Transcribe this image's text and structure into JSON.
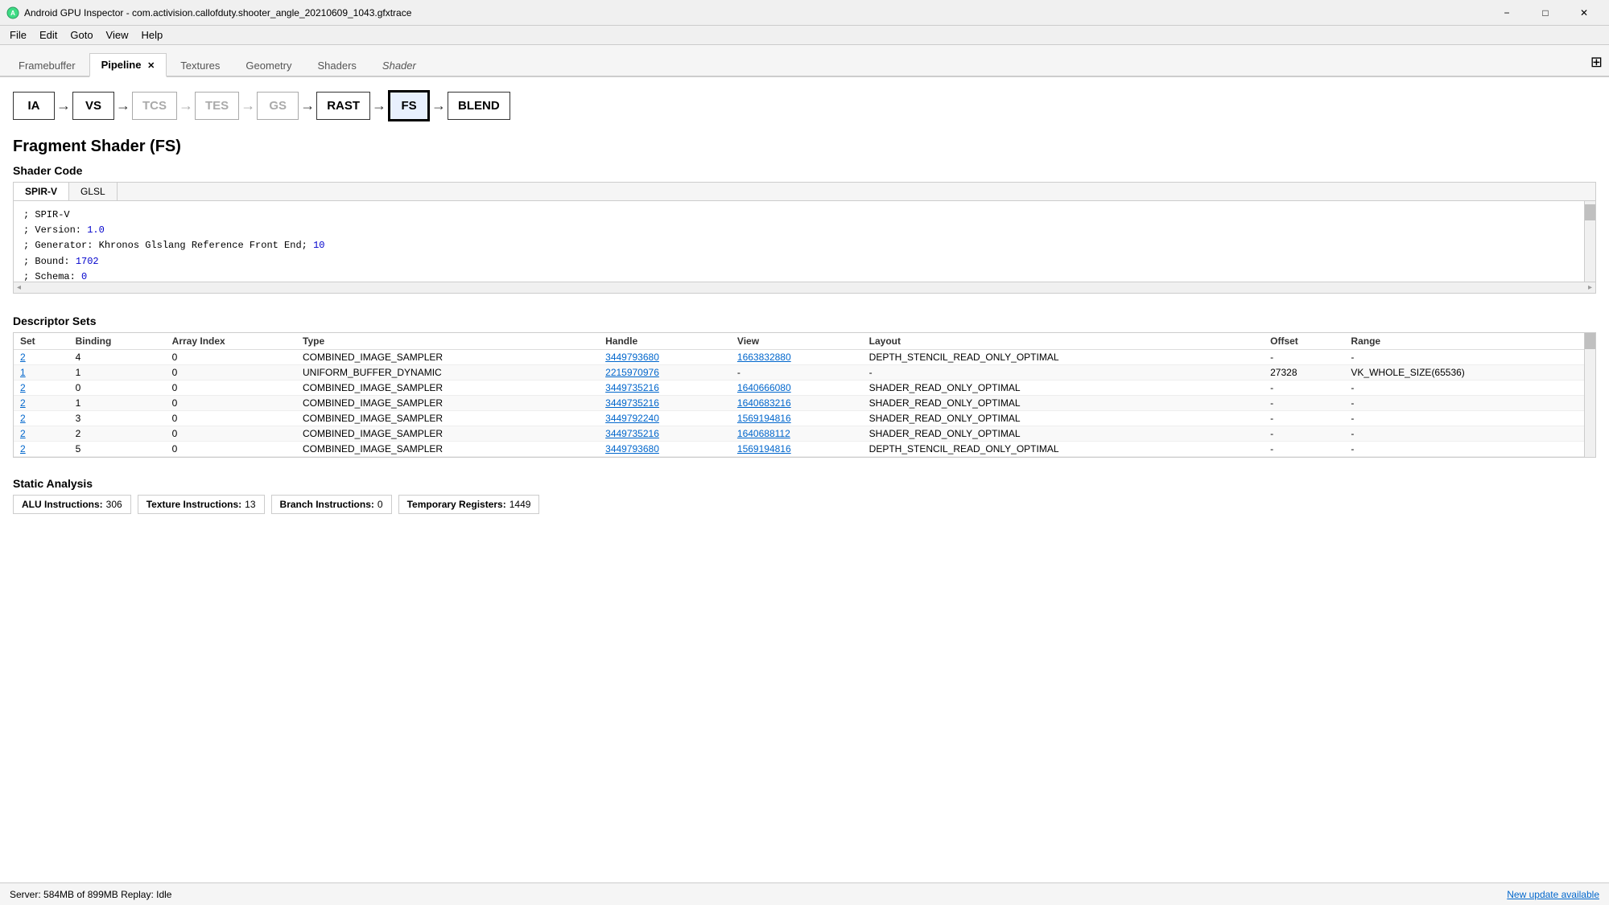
{
  "window": {
    "title": "Android GPU Inspector - com.activision.callofduty.shooter_angle_20210609_1043.gfxtrace",
    "icon": "android-icon"
  },
  "window_controls": {
    "minimize": "−",
    "maximize": "□",
    "close": "✕"
  },
  "menu": {
    "items": [
      "File",
      "Edit",
      "Goto",
      "View",
      "Help"
    ]
  },
  "tabs": [
    {
      "id": "framebuffer",
      "label": "Framebuffer",
      "active": false,
      "closeable": false
    },
    {
      "id": "pipeline",
      "label": "Pipeline",
      "active": true,
      "closeable": true
    },
    {
      "id": "textures",
      "label": "Textures",
      "active": false,
      "closeable": false
    },
    {
      "id": "geometry",
      "label": "Geometry",
      "active": false,
      "closeable": false
    },
    {
      "id": "shaders",
      "label": "Shaders",
      "active": false,
      "closeable": false
    },
    {
      "id": "shader",
      "label": "Shader",
      "active": false,
      "closeable": false,
      "italic": true
    }
  ],
  "maximize_icon": "⊞",
  "pipeline": {
    "nodes": [
      {
        "id": "ia",
        "label": "IA",
        "active": false,
        "dimmed": false
      },
      {
        "id": "vs",
        "label": "VS",
        "active": false,
        "dimmed": false
      },
      {
        "id": "tcs",
        "label": "TCS",
        "active": false,
        "dimmed": true
      },
      {
        "id": "tes",
        "label": "TES",
        "active": false,
        "dimmed": true
      },
      {
        "id": "gs",
        "label": "GS",
        "active": false,
        "dimmed": true
      },
      {
        "id": "rast",
        "label": "RAST",
        "active": false,
        "dimmed": false
      },
      {
        "id": "fs",
        "label": "FS",
        "active": true,
        "dimmed": false
      },
      {
        "id": "blend",
        "label": "BLEND",
        "active": false,
        "dimmed": false
      }
    ]
  },
  "section": {
    "title": "Fragment Shader (FS)",
    "shader_code_title": "Shader Code",
    "code_tabs": [
      "SPIR-V",
      "GLSL"
    ],
    "active_code_tab": "SPIR-V",
    "code_lines": [
      "; SPIR-V",
      "; Version: 1.0",
      "; Generator: Khronos Glslang Reference Front End; 10",
      "; Bound: 1702",
      "; Schema: 0"
    ],
    "code_highlights": {
      "version": "1.0",
      "generator_end": "10",
      "bound_val": "1702",
      "schema_val": "0"
    }
  },
  "descriptor_sets": {
    "title": "Descriptor Sets",
    "columns": [
      "Set",
      "Binding",
      "Array Index",
      "Type",
      "Handle",
      "View",
      "Layout",
      "Offset",
      "Range"
    ],
    "rows": [
      {
        "set": "2",
        "binding": "4",
        "array_index": "0",
        "type": "COMBINED_IMAGE_SAMPLER",
        "handle": "3449793680",
        "view": "1663832880",
        "layout": "DEPTH_STENCIL_READ_ONLY_OPTIMAL",
        "offset": "-",
        "range": "-"
      },
      {
        "set": "1",
        "binding": "1",
        "array_index": "0",
        "type": "UNIFORM_BUFFER_DYNAMIC",
        "handle": "2215970976",
        "view": "-",
        "layout": "-",
        "offset": "27328",
        "range": "VK_WHOLE_SIZE(65536)"
      },
      {
        "set": "2",
        "binding": "0",
        "array_index": "0",
        "type": "COMBINED_IMAGE_SAMPLER",
        "handle": "3449735216",
        "view": "1640666080",
        "layout": "SHADER_READ_ONLY_OPTIMAL",
        "offset": "-",
        "range": "-"
      },
      {
        "set": "2",
        "binding": "1",
        "array_index": "0",
        "type": "COMBINED_IMAGE_SAMPLER",
        "handle": "3449735216",
        "view": "1640683216",
        "layout": "SHADER_READ_ONLY_OPTIMAL",
        "offset": "-",
        "range": "-"
      },
      {
        "set": "2",
        "binding": "3",
        "array_index": "0",
        "type": "COMBINED_IMAGE_SAMPLER",
        "handle": "3449792240",
        "view": "1569194816",
        "layout": "SHADER_READ_ONLY_OPTIMAL",
        "offset": "-",
        "range": "-"
      },
      {
        "set": "2",
        "binding": "2",
        "array_index": "0",
        "type": "COMBINED_IMAGE_SAMPLER",
        "handle": "3449735216",
        "view": "1640688112",
        "layout": "SHADER_READ_ONLY_OPTIMAL",
        "offset": "-",
        "range": "-"
      },
      {
        "set": "2",
        "binding": "5",
        "array_index": "0",
        "type": "COMBINED_IMAGE_SAMPLER",
        "handle": "3449793680",
        "view": "1569194816",
        "layout": "DEPTH_STENCIL_READ_ONLY_OPTIMAL",
        "offset": "-",
        "range": "-"
      }
    ]
  },
  "static_analysis": {
    "title": "Static Analysis",
    "stats": [
      {
        "label": "ALU Instructions:",
        "value": "306"
      },
      {
        "label": "Texture Instructions:",
        "value": "13"
      },
      {
        "label": "Branch Instructions:",
        "value": "0"
      },
      {
        "label": "Temporary Registers:",
        "value": "1449"
      }
    ]
  },
  "status_bar": {
    "server": "Server:",
    "server_value": "584MB of 899MB",
    "replay": "Replay: Idle",
    "update": "New update available"
  }
}
